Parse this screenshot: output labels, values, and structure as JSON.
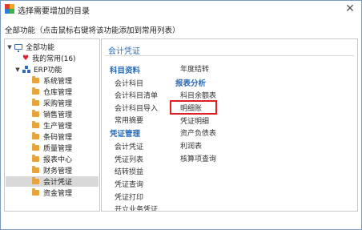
{
  "window": {
    "title": "选择需要增加的目录",
    "close_glyph": "✕",
    "hint": "全部功能（点击鼠标右键将该功能添加到常用列表）"
  },
  "tree": {
    "root": "全部功能",
    "favorites": "我的常用(16)",
    "erp": "ERP功能",
    "modules": [
      {
        "label": "系统管理"
      },
      {
        "label": "仓库管理"
      },
      {
        "label": "采购管理"
      },
      {
        "label": "销售管理"
      },
      {
        "label": "生产管理"
      },
      {
        "label": "条码管理"
      },
      {
        "label": "质量管理"
      },
      {
        "label": "报表中心"
      },
      {
        "label": "财务管理"
      },
      {
        "label": "会计凭证"
      },
      {
        "label": "资金管理"
      }
    ],
    "selected_module": "会计凭证"
  },
  "content": {
    "section_title": "会计凭证",
    "col1": {
      "head1": "科目资料",
      "items1": [
        "会计科目",
        "会计科目清单",
        "会计科目导入",
        "常用摘要"
      ],
      "head2": "凭证管理",
      "items2": [
        "会计凭证",
        "凭证列表",
        "结转损益",
        "凭证查询",
        "凭证打印",
        "开立业务凭证"
      ]
    },
    "col2": {
      "items_top": [
        "年度结转"
      ],
      "head": "报表分析",
      "items": [
        "科目余额表",
        "明细账",
        "凭证明细",
        "资产负债表",
        "利润表",
        "核算项查询"
      ],
      "highlighted": "明细账"
    }
  },
  "colors": {
    "accent": "#2a6bb8",
    "highlight": "#e02020",
    "folder": "#e8a33b",
    "heart": "#d9252a"
  }
}
